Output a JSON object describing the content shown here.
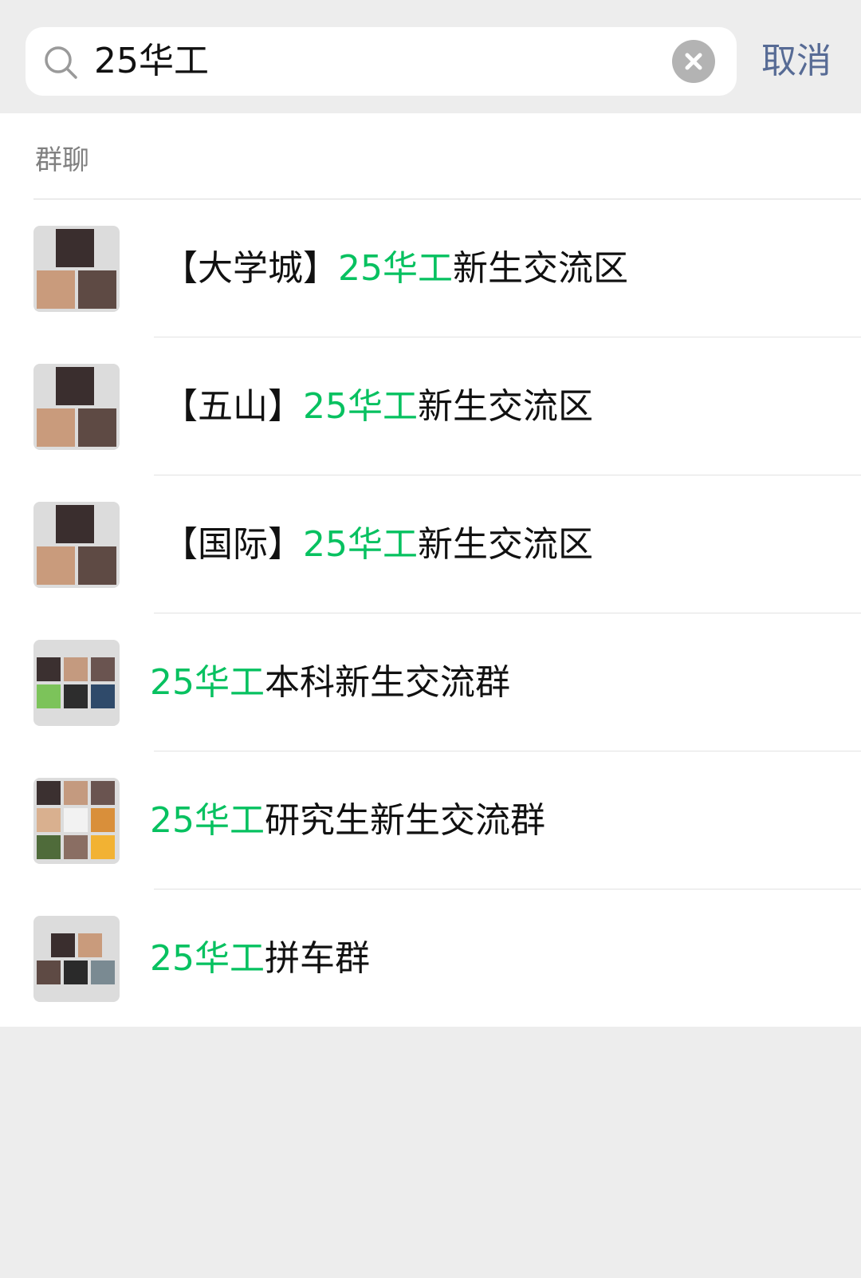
{
  "search": {
    "query": "25华工",
    "cancel_label": "取消"
  },
  "section": {
    "title": "群聊"
  },
  "results": [
    {
      "prefix": "【大学城】",
      "highlight": "25华工",
      "suffix": "新生交流区",
      "avatar_layout": "3-grid",
      "avatar_colors": [
        "#3a2e2e",
        "#c99b7c",
        "#5e4a44"
      ]
    },
    {
      "prefix": "【五山】",
      "highlight": "25华工",
      "suffix": "新生交流区",
      "avatar_layout": "3-grid",
      "avatar_colors": [
        "#3a2e2e",
        "#c99b7c",
        "#5e4a44"
      ]
    },
    {
      "prefix": "【国际】",
      "highlight": "25华工",
      "suffix": "新生交流区",
      "avatar_layout": "3-grid",
      "avatar_colors": [
        "#3a2e2e",
        "#c99b7c",
        "#5e4a44"
      ]
    },
    {
      "prefix": "",
      "highlight": "25华工",
      "suffix": "本科新生交流群",
      "avatar_layout": "6-grid",
      "avatar_colors": [
        "#3b3030",
        "#c49a7f",
        "#6a5450",
        "#7cc35a",
        "#2d2d2d",
        "#2f4a6a"
      ]
    },
    {
      "prefix": "",
      "highlight": "25华工",
      "suffix": "研究生新生交流群",
      "avatar_layout": "9-grid",
      "avatar_colors": [
        "#3b3030",
        "#c49a7f",
        "#6a5450",
        "#d9b08f",
        "#f2f2f2",
        "#d98f3a",
        "#4f6b3a",
        "#8a6e63",
        "#f2b233"
      ]
    },
    {
      "prefix": "",
      "highlight": "25华工",
      "suffix": "拼车群",
      "avatar_layout": "5-grid",
      "avatar_colors": [
        "#3a2e2e",
        "#c99b7c",
        "#5e4a44",
        "#2a2a2a",
        "#7a8a92"
      ]
    }
  ],
  "colors": {
    "highlight": "#07c160",
    "cancel": "#576b95",
    "clear_button": "#b3b3b3"
  }
}
